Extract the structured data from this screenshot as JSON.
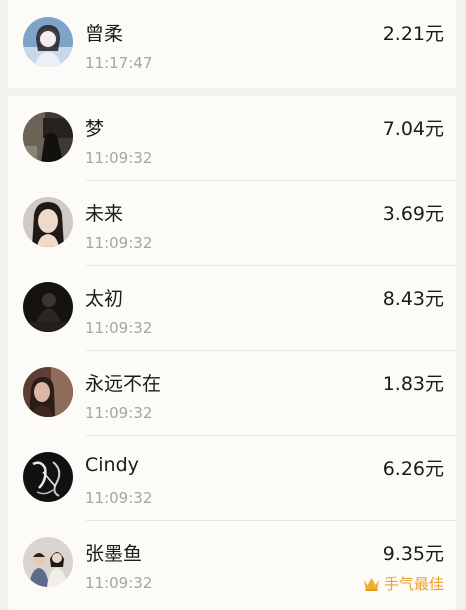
{
  "top_entry": {
    "name": "曾柔",
    "time": "11:17:47",
    "amount": "2.21元",
    "avatar_icon": "user-avatar-icon"
  },
  "entries": [
    {
      "name": "梦",
      "time": "11:09:32",
      "amount": "7.04元",
      "avatar_icon": "user-avatar-icon"
    },
    {
      "name": "未来",
      "time": "11:09:32",
      "amount": "3.69元",
      "avatar_icon": "user-avatar-icon"
    },
    {
      "name": "太初",
      "time": "11:09:32",
      "amount": "8.43元",
      "avatar_icon": "user-avatar-icon"
    },
    {
      "name": "永远不在",
      "time": "11:09:32",
      "amount": "1.83元",
      "avatar_icon": "user-avatar-icon"
    },
    {
      "name": "Cindy",
      "time": "11:09:32",
      "amount": "6.26元",
      "avatar_icon": "user-avatar-icon"
    },
    {
      "name": "张墨鱼",
      "time": "11:09:32",
      "amount": "9.35元",
      "avatar_icon": "user-avatar-icon",
      "badge": "手气最佳",
      "badge_icon": "crown-icon"
    }
  ],
  "colors": {
    "badge": "#e9a22a",
    "time": "#a5a5a5",
    "text": "#1b1b1b",
    "card": "#fdfbf8",
    "background": "#f3f1ee"
  }
}
